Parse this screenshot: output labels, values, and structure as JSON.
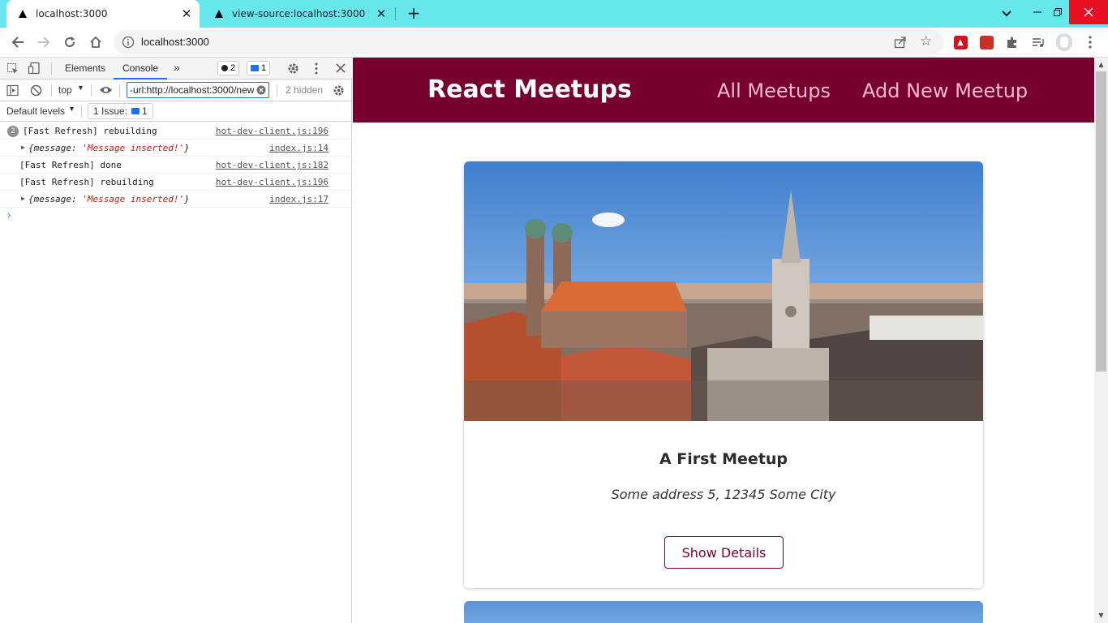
{
  "browser": {
    "tabs": [
      {
        "title": "localhost:3000",
        "active": true
      },
      {
        "title": "view-source:localhost:3000",
        "active": false
      }
    ],
    "new_tab_icon": "plus-icon",
    "address": "localhost:3000",
    "colors": {
      "tabstrip": "#67e6ec",
      "close_button": "#e81123"
    }
  },
  "devtools": {
    "tabs": [
      "Elements",
      "Console"
    ],
    "active_tab": "Console",
    "error_badge": "2",
    "message_badge": "1",
    "context": "top",
    "filter_value": "-url:http://localhost:3000/new",
    "hidden_count": "2 hidden",
    "levels": "Default levels",
    "issues_label": "1 Issue:",
    "issues_count": "1",
    "logs": [
      {
        "count": "2",
        "text": "[Fast Refresh] rebuilding",
        "source": "hot-dev-client.js:196"
      },
      {
        "prefix": "{message: ",
        "value": "'Message inserted!'",
        "suffix": "}",
        "source": "index.js:14"
      },
      {
        "text": "[Fast Refresh] done",
        "source": "hot-dev-client.js:182"
      },
      {
        "text": "[Fast Refresh] rebuilding",
        "source": "hot-dev-client.js:196"
      },
      {
        "prefix": "{message: ",
        "value": "'Message inserted!'",
        "suffix": "}",
        "source": "index.js:17"
      }
    ],
    "prompt": "›"
  },
  "app": {
    "logo": "React Meetups",
    "nav": [
      "All Meetups",
      "Add New Meetup"
    ],
    "meetup": {
      "title": "A First Meetup",
      "address": "Some address 5, 12345 Some City",
      "button": "Show Details"
    },
    "colors": {
      "header": "#77002e",
      "nav_link": "#fcb8d2"
    }
  }
}
